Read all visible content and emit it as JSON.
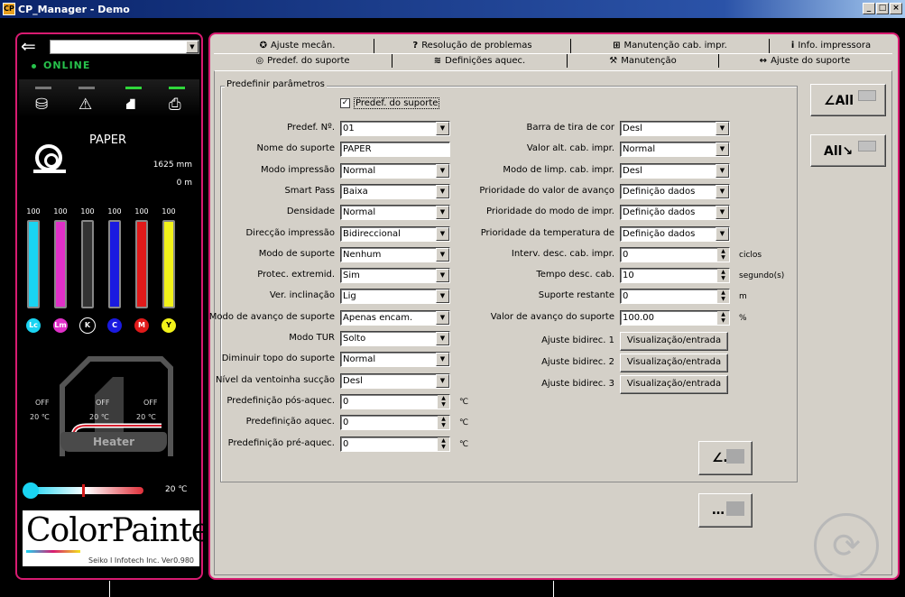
{
  "window": {
    "title": "CP_Manager - Demo",
    "icon": "app-icon",
    "btn_min": "_",
    "btn_max": "□",
    "btn_close": "×"
  },
  "left": {
    "back_icon": "back-arrow-icon",
    "back_glyph": "⇐",
    "media_select": "",
    "status": "ONLINE",
    "status_icons": [
      "media-roll-icon",
      "warning-icon",
      "ink-tank-icon",
      "printer-icon"
    ],
    "status_glyphs": [
      "⛁",
      "⚠",
      "⛘",
      "⎙"
    ],
    "paper_name": "PAPER",
    "length1": "1625 mm",
    "length2": "0 m",
    "inks": [
      {
        "code": "Lc",
        "level": "100",
        "fill": 1.0,
        "color": "#1ad4f2"
      },
      {
        "code": "Lm",
        "level": "100",
        "fill": 1.0,
        "color": "#e030c8"
      },
      {
        "code": "K",
        "level": "100",
        "fill": 1.0,
        "color": "#333333"
      },
      {
        "code": "C",
        "level": "100",
        "fill": 1.0,
        "color": "#1a1ae0"
      },
      {
        "code": "M",
        "level": "100",
        "fill": 1.0,
        "color": "#e01a1a"
      },
      {
        "code": "Y",
        "level": "100",
        "fill": 1.0,
        "color": "#f2f21a"
      }
    ],
    "heater": {
      "post_state": "OFF",
      "post_temp": "20 ℃",
      "print_state": "OFF",
      "print_temp": "20 ℃",
      "pre_state": "OFF",
      "pre_temp": "20 ℃",
      "label": "Heater"
    },
    "ambient_temp": "20 ℃",
    "logo_text": "ColorPainter",
    "logo_sub": "Seiko I Infotech Inc.  Ver0.980"
  },
  "tabs_row1": [
    {
      "icon": "wrench-adjust-icon",
      "glyph": "✪",
      "label": "Ajuste mecân."
    },
    {
      "icon": "question-icon",
      "glyph": "?",
      "label": "Resolução de problemas"
    },
    {
      "icon": "head-maintenance-icon",
      "glyph": "⊞",
      "label": "Manutenção cab. impr."
    },
    {
      "icon": "info-icon",
      "glyph": "i",
      "label": "Info. impressora"
    }
  ],
  "tabs_row2": [
    {
      "icon": "media-preset-icon",
      "glyph": "◎",
      "label": "Predef. do suporte"
    },
    {
      "icon": "heater-icon",
      "glyph": "≋",
      "label": "Definições aquec."
    },
    {
      "icon": "maintenance-icon",
      "glyph": "⚒",
      "label": "Manutenção"
    },
    {
      "icon": "media-adjust-icon",
      "glyph": "↔",
      "label": "Ajuste do suporte"
    }
  ],
  "group_title": "Predefinir parâmetros",
  "preset_checkbox": {
    "label": "Predef. do suporte",
    "checked": "✓"
  },
  "left_fields": [
    {
      "label": "Predef. Nº.",
      "value": "01",
      "kind": "select"
    },
    {
      "label": "Nome do suporte",
      "value": "PAPER",
      "kind": "text"
    },
    {
      "label": "Modo impressão",
      "value": "Normal",
      "kind": "select"
    },
    {
      "label": "Smart Pass",
      "value": "Baixa",
      "kind": "select"
    },
    {
      "label": "Densidade",
      "value": "Normal",
      "kind": "select"
    },
    {
      "label": "Direcção impressão",
      "value": "Bidireccional",
      "kind": "select"
    },
    {
      "label": "Modo de suporte",
      "value": "Nenhum",
      "kind": "select"
    },
    {
      "label": "Protec. extremid.",
      "value": "Sim",
      "kind": "select"
    },
    {
      "label": "Ver. inclinação",
      "value": "Lig",
      "kind": "select"
    },
    {
      "label": "Modo de avanço de suporte",
      "value": "Apenas encam.",
      "kind": "select"
    },
    {
      "label": "Modo TUR",
      "value": "Solto",
      "kind": "select"
    },
    {
      "label": "Diminuir topo do suporte",
      "value": "Normal",
      "kind": "select"
    },
    {
      "label": "Nível da ventoinha sucção",
      "value": "Desl",
      "kind": "select"
    },
    {
      "label": "Predefinição pós-aquec.",
      "value": "0",
      "kind": "spin",
      "unit": "℃"
    },
    {
      "label": "Predefinição aquec.",
      "value": "0",
      "kind": "spin",
      "unit": "℃"
    },
    {
      "label": "Predefinição pré-aquec.",
      "value": "0",
      "kind": "spin",
      "unit": "℃"
    }
  ],
  "right_fields": [
    {
      "label": "Barra de tira de cor",
      "value": "Desl",
      "kind": "select"
    },
    {
      "label": "Valor alt. cab. impr.",
      "value": "Normal",
      "kind": "select"
    },
    {
      "label": "Modo de limp. cab. impr.",
      "value": "Desl",
      "kind": "select"
    },
    {
      "label": "Prioridade do valor de avanço",
      "value": "Definição dados",
      "kind": "select"
    },
    {
      "label": "Prioridade do modo de impr.",
      "value": "Definição dados",
      "kind": "select"
    },
    {
      "label": "Prioridade da temperatura de",
      "value": "Definição dados",
      "kind": "select"
    },
    {
      "label": "Interv. desc. cab. impr.",
      "value": "0",
      "kind": "spin",
      "unit": "ciclos"
    },
    {
      "label": "Tempo desc. cab.",
      "value": "10",
      "kind": "spin",
      "unit": "segundo(s)"
    },
    {
      "label": "Suporte restante",
      "value": "0",
      "kind": "spin",
      "unit": "m"
    },
    {
      "label": "Valor de avanço do suporte",
      "value": "100.00",
      "kind": "spin",
      "unit": "%"
    }
  ],
  "bidir": [
    {
      "label": "Ajuste bidirec. 1",
      "button": "Visualização/entrada"
    },
    {
      "label": "Ajuste bidirec. 2",
      "button": "Visualização/entrada"
    },
    {
      "label": "Ajuste bidirec. 3",
      "button": "Visualização/entrada"
    }
  ],
  "side_buttons": {
    "load_all": "All",
    "save_all": "All",
    "load_glyph": "∠",
    "save_glyph": "↘",
    "load_dots": "…",
    "save_dots": "…"
  },
  "refresh_icon": "refresh-icon",
  "refresh_glyph": "⟳",
  "spin_up": "▲",
  "spin_down": "▼",
  "dd_arrow": "▼"
}
